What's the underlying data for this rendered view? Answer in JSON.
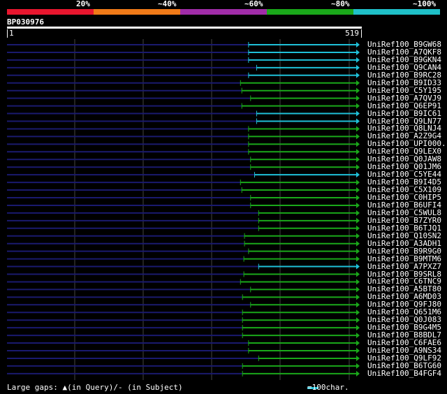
{
  "legend": {
    "colors": [
      "#e8162e",
      "#f07a18",
      "#a02ca8",
      "#1aa81a",
      "#1fc0c8"
    ],
    "labels": [
      "20%",
      "~40%",
      "~60%",
      "~80%",
      "~100%"
    ]
  },
  "query": {
    "name": "BP030976",
    "start_label": "1",
    "end_label": "519"
  },
  "colors": {
    "green": "#1aa81a",
    "cyan": "#1fc0d8",
    "navy": "#1a1a6e",
    "grid": "#444444"
  },
  "hits": [
    {
      "name": "UniRef100_B9GW68",
      "start": 359,
      "color": "cyan"
    },
    {
      "name": "UniRef100_A7QKF8",
      "start": 359,
      "color": "cyan"
    },
    {
      "name": "UniRef100_B9GKN4",
      "start": 359,
      "color": "cyan"
    },
    {
      "name": "UniRef100_Q9CAN4",
      "start": 371,
      "color": "cyan"
    },
    {
      "name": "UniRef100_B9RC28",
      "start": 359,
      "color": "cyan"
    },
    {
      "name": "UniRef100_B9ID33",
      "start": 347,
      "color": "green"
    },
    {
      "name": "UniRef100_C5Y195",
      "start": 349,
      "color": "green"
    },
    {
      "name": "UniRef100_A7QVJ9",
      "start": 362,
      "color": "green"
    },
    {
      "name": "UniRef100_Q6EP91",
      "start": 349,
      "color": "green"
    },
    {
      "name": "UniRef100_B9IC61",
      "start": 371,
      "color": "cyan"
    },
    {
      "name": "UniRef100_Q9LN77",
      "start": 371,
      "color": "cyan"
    },
    {
      "name": "UniRef100_Q8LNJ4",
      "start": 359,
      "color": "green"
    },
    {
      "name": "UniRef100_A2Z9G4",
      "start": 359,
      "color": "green"
    },
    {
      "name": "UniRef100_UPI000...",
      "start": 359,
      "color": "green"
    },
    {
      "name": "UniRef100_Q9LEX0",
      "start": 359,
      "color": "green"
    },
    {
      "name": "UniRef100_Q0JAW8",
      "start": 362,
      "color": "green"
    },
    {
      "name": "UniRef100_Q01JM6",
      "start": 362,
      "color": "green"
    },
    {
      "name": "UniRef100_C5YE44",
      "start": 368,
      "color": "cyan"
    },
    {
      "name": "UniRef100_B9I4D5",
      "start": 347,
      "color": "green"
    },
    {
      "name": "UniRef100_C5X109",
      "start": 349,
      "color": "green"
    },
    {
      "name": "UniRef100_C0HIP5",
      "start": 362,
      "color": "green"
    },
    {
      "name": "UniRef100_B6UFI4",
      "start": 362,
      "color": "green"
    },
    {
      "name": "UniRef100_C5WUL8",
      "start": 374,
      "color": "green"
    },
    {
      "name": "UniRef100_B7ZYR0",
      "start": 374,
      "color": "green"
    },
    {
      "name": "UniRef100_B6TJQ1",
      "start": 374,
      "color": "green"
    },
    {
      "name": "UniRef100_Q10SN2",
      "start": 353,
      "color": "green"
    },
    {
      "name": "UniRef100_A3ADH1",
      "start": 353,
      "color": "green"
    },
    {
      "name": "UniRef100_B9R9G0",
      "start": 359,
      "color": "green"
    },
    {
      "name": "UniRef100_B9MTM6",
      "start": 352,
      "color": "green"
    },
    {
      "name": "UniRef100_A7PXZ7",
      "start": 374,
      "color": "cyan"
    },
    {
      "name": "UniRef100_B9SRL8",
      "start": 352,
      "color": "green"
    },
    {
      "name": "UniRef100_C6TNC9",
      "start": 347,
      "color": "green"
    },
    {
      "name": "UniRef100_A5BT80",
      "start": 362,
      "color": "green"
    },
    {
      "name": "UniRef100_A6MD03",
      "start": 350,
      "color": "green"
    },
    {
      "name": "UniRef100_Q9FJ80",
      "start": 362,
      "color": "green"
    },
    {
      "name": "UniRef100_Q651M6",
      "start": 350,
      "color": "green"
    },
    {
      "name": "UniRef100_Q0J083",
      "start": 350,
      "color": "green"
    },
    {
      "name": "UniRef100_B9G4M5",
      "start": 350,
      "color": "green"
    },
    {
      "name": "UniRef100_B8BDL7",
      "start": 350,
      "color": "green"
    },
    {
      "name": "UniRef100_C6FAE6",
      "start": 359,
      "color": "green"
    },
    {
      "name": "UniRef100_A9NS34",
      "start": 359,
      "color": "green"
    },
    {
      "name": "UniRef100_Q9LF92",
      "start": 374,
      "color": "green"
    },
    {
      "name": "UniRef100_B6TG60",
      "start": 350,
      "color": "green"
    },
    {
      "name": "UniRef100_B4FGF4",
      "start": 350,
      "color": "green"
    }
  ],
  "footer": {
    "gaps_text": "Large gaps: ▲(in Query)/- (in Subject)",
    "scale_text": "   =100char."
  }
}
